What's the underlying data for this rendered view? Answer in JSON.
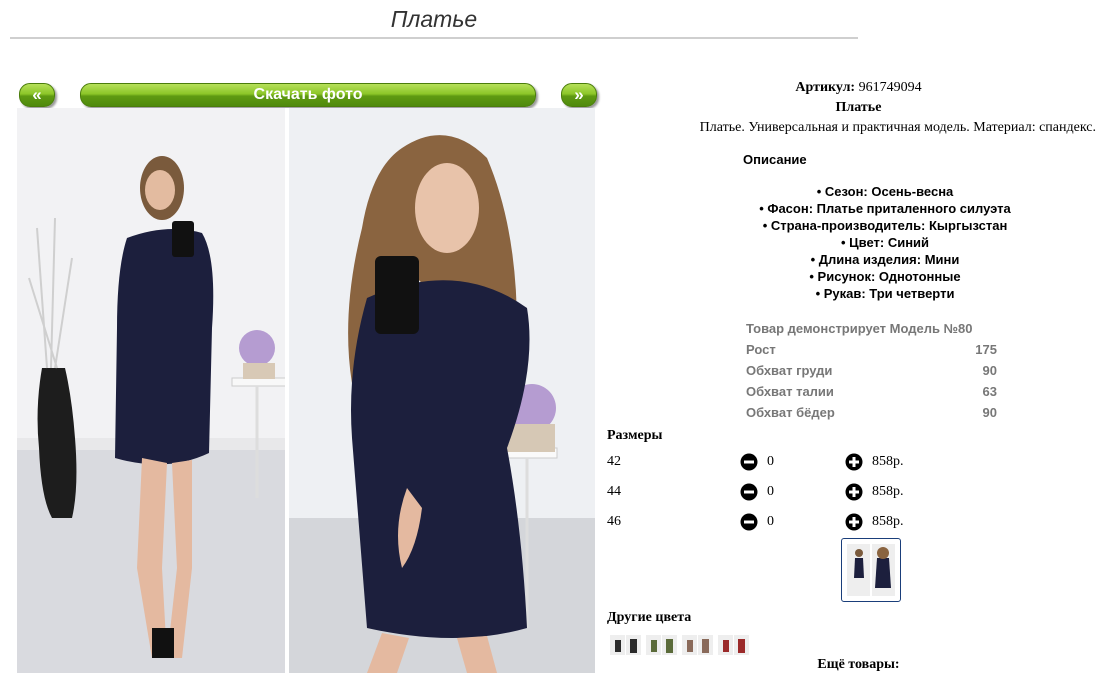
{
  "page": {
    "title": "Платье"
  },
  "gallery": {
    "prev_label": "«",
    "download_label": "Скачать фото",
    "next_label": "»"
  },
  "product": {
    "article_label": "Артикул:",
    "article_value": "961749094",
    "name": "Платье",
    "description": "Платье. Универсальная и практичная модель. Материал: спандекс."
  },
  "description": {
    "heading": "Описание",
    "features": [
      "• Сезон: Осень-весна",
      "• Фасон: Платье приталенного силуэта",
      "• Страна-производитель: Кыргызстан",
      "• Цвет: Синий",
      "• Длина изделия: Мини",
      "• Рисунок: Однотонные",
      "• Рукав: Три четверти"
    ]
  },
  "model": {
    "rows": [
      {
        "label": "Товар демонстрирует Модель №80",
        "value": ""
      },
      {
        "label": "Рост",
        "value": "175"
      },
      {
        "label": "Обхват груди",
        "value": "90"
      },
      {
        "label": "Обхват талии",
        "value": "63"
      },
      {
        "label": "Обхват бёдер",
        "value": "90"
      }
    ]
  },
  "sizes": {
    "heading": "Размеры",
    "rows": [
      {
        "size": "42",
        "qty": "0",
        "price": "858р."
      },
      {
        "size": "44",
        "qty": "0",
        "price": "858р."
      },
      {
        "size": "46",
        "qty": "0",
        "price": "858р."
      }
    ]
  },
  "other_colors": {
    "heading": "Другие цвета",
    "swatches": [
      "#2b2b2b",
      "#5b6b3a",
      "#8a6a5a",
      "#9b2a2a"
    ]
  },
  "more_goods": {
    "label": "Ещё товары:"
  },
  "colors": {
    "accent_green": "#8cc628",
    "dress_navy": "#1c1f3d",
    "thumb_border": "#1a3e7a"
  }
}
